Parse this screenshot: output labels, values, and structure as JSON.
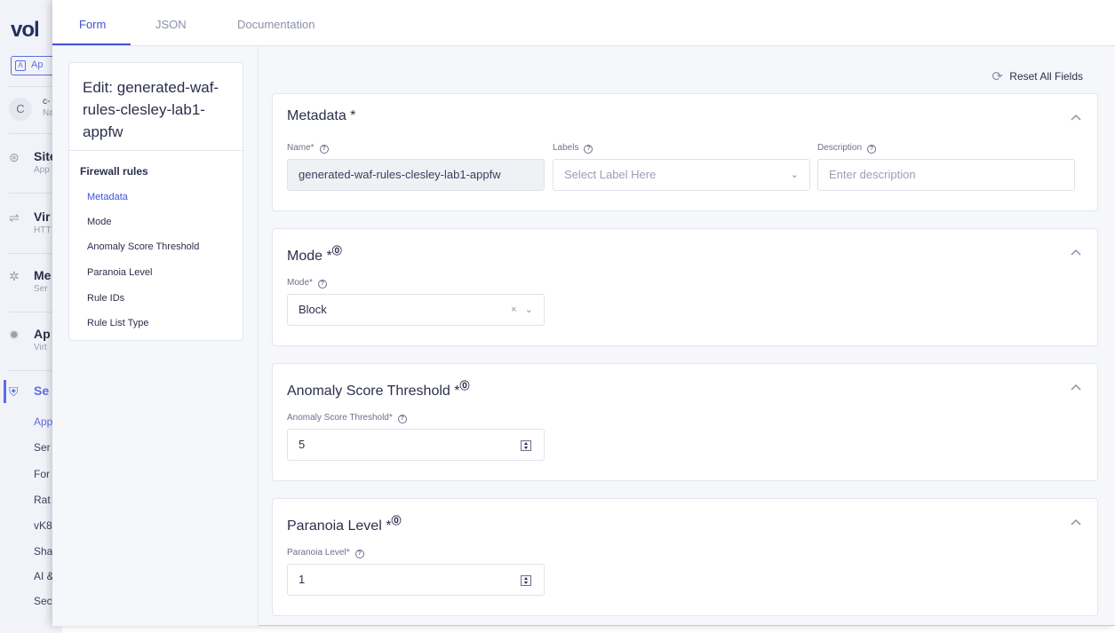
{
  "background_app": {
    "logo": "vol",
    "namespace_button": "Ap",
    "tenant": {
      "initial": "C",
      "line1": "c-",
      "line2": "Na"
    },
    "nav": [
      {
        "icon": "globe-icon",
        "label": "Site",
        "sub": "App"
      },
      {
        "icon": "virtual-host-icon",
        "label": "Vir",
        "sub": "HTT"
      },
      {
        "icon": "mesh-icon",
        "label": "Me",
        "sub": "Ser"
      },
      {
        "icon": "gear-icon",
        "label": "Ap",
        "sub": "Virt"
      },
      {
        "icon": "shield-icon",
        "label": "Se",
        "sub": ""
      }
    ],
    "sub_items": [
      "App",
      "Ser",
      "For",
      "Rat",
      "vK8",
      "Sha",
      "AI &",
      "Sec"
    ]
  },
  "tabs": [
    "Form",
    "JSON",
    "Documentation"
  ],
  "toc": {
    "title": "Edit: generated-waf-rules-clesley-lab1-appfw",
    "section": "Firewall rules",
    "links": [
      "Metadata",
      "Mode",
      "Anomaly Score Threshold",
      "Paranoia Level",
      "Rule IDs",
      "Rule List Type"
    ]
  },
  "reset_label": "Reset All Fields",
  "metadata": {
    "title": "Metadata",
    "required_mark": "*",
    "name_label": "Name*",
    "name_value": "generated-waf-rules-clesley-lab1-appfw",
    "labels_label": "Labels",
    "labels_placeholder": "Select Label Here",
    "description_label": "Description",
    "description_placeholder": "Enter description"
  },
  "mode": {
    "title": "Mode",
    "required_mark": "*",
    "field_label": "Mode*",
    "value": "Block"
  },
  "anomaly": {
    "title": "Anomaly Score Threshold",
    "required_mark": "*",
    "field_label": "Anomaly Score Threshold*",
    "value": "5"
  },
  "paranoia": {
    "title": "Paranoia Level",
    "required_mark": "*",
    "field_label": "Paranoia Level*",
    "value": "1"
  },
  "glyphs": {
    "help": "?",
    "clear": "×",
    "chevron_down": "⌄",
    "reset": "⟳"
  },
  "colors": {
    "accent": "#3f51d8",
    "text": "#2b2f4b",
    "muted": "#8b91a7"
  }
}
